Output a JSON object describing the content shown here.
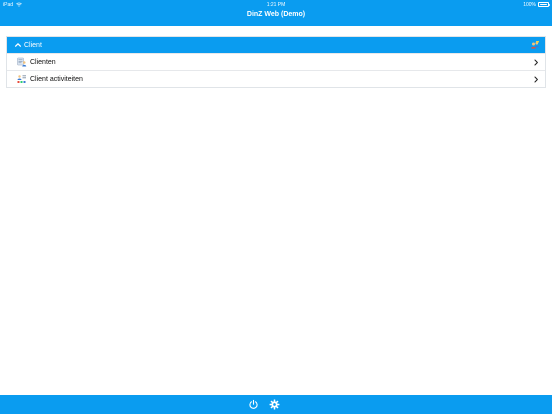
{
  "status_bar": {
    "device": "iPad",
    "time": "1:21 PM",
    "battery": "100%"
  },
  "header": {
    "title": "DinZ Web (Demo)"
  },
  "panel": {
    "title": "Client",
    "items": [
      {
        "label": "Clienten",
        "icon": "client-list-icon"
      },
      {
        "label": "Client activiteiten",
        "icon": "client-activities-icon"
      }
    ]
  },
  "footer": {
    "buttons": [
      {
        "name": "power-icon"
      },
      {
        "name": "gear-icon"
      }
    ]
  },
  "colors": {
    "accent": "#0a9cf0",
    "background": "#ffffff",
    "divider": "#e6e8eb"
  }
}
